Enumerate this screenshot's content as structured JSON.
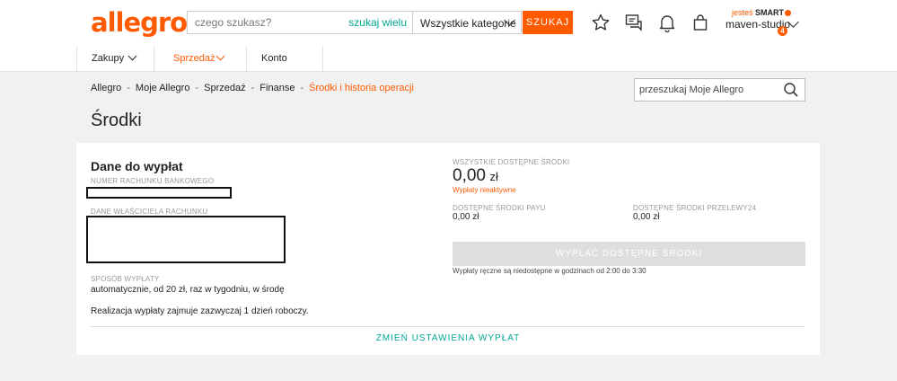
{
  "header": {
    "logo": "allegro",
    "search_placeholder": "czego szukasz?",
    "search_many": "szukaj wielu",
    "category": "Wszystkie kategorie",
    "search_button": "SZUKAJ",
    "smart_prefix": "jesteś",
    "smart_label": "SMART",
    "username": "maven-studio",
    "notifications_count": "4"
  },
  "nav": [
    {
      "label": "Zakupy"
    },
    {
      "label": "Sprzedaż"
    },
    {
      "label": "Konto"
    }
  ],
  "breadcrumb": [
    "Allegro",
    "Moje Allegro",
    "Sprzedaż",
    "Finanse",
    "Środki i historia operacji"
  ],
  "breadcrumb_sep": "-",
  "side_search_placeholder": "przeszukaj Moje Allegro",
  "page_title": "Środki",
  "payout_data": {
    "heading": "Dane do wypłat",
    "account_number_label": "NUMER RACHUNKU BANKOWEGO",
    "owner_label": "DANE WŁAŚCICIELA RACHUNKU",
    "method_label": "SPOSÓB WYPŁATY",
    "method_value": "automatycznie, od 20 zł, raz w tygodniu, w środę",
    "realization_note": "Realizacja wypłaty zajmuje zazwyczaj 1 dzień roboczy.",
    "change_link": "ZMIEŃ USTAWIENIA WYPŁAT"
  },
  "funds": {
    "all_label": "WSZYSTKIE DOSTĘPNE ŚRODKI",
    "all_amount": "0,00",
    "all_currency": "zł",
    "status": "Wypłaty nieaktywne",
    "payu_label": "DOSTĘPNE ŚRODKI PAYU",
    "payu_value": "0,00 zł",
    "p24_label": "DOSTĘPNE ŚRODKI PRZELEWY24",
    "p24_value": "0,00 zł",
    "payout_button": "WYPŁAĆ DOSTĘPNE ŚRODKI",
    "payout_note": "Wypłaty ręczne są niedostępne w godzinach od 2:00 do 3:30"
  },
  "colors": {
    "brand": "#ff5a00",
    "link": "#00a790"
  },
  "icons": [
    "star-icon",
    "messages-icon",
    "bell-icon",
    "cart-icon",
    "search-icon",
    "chevron-down-icon"
  ]
}
